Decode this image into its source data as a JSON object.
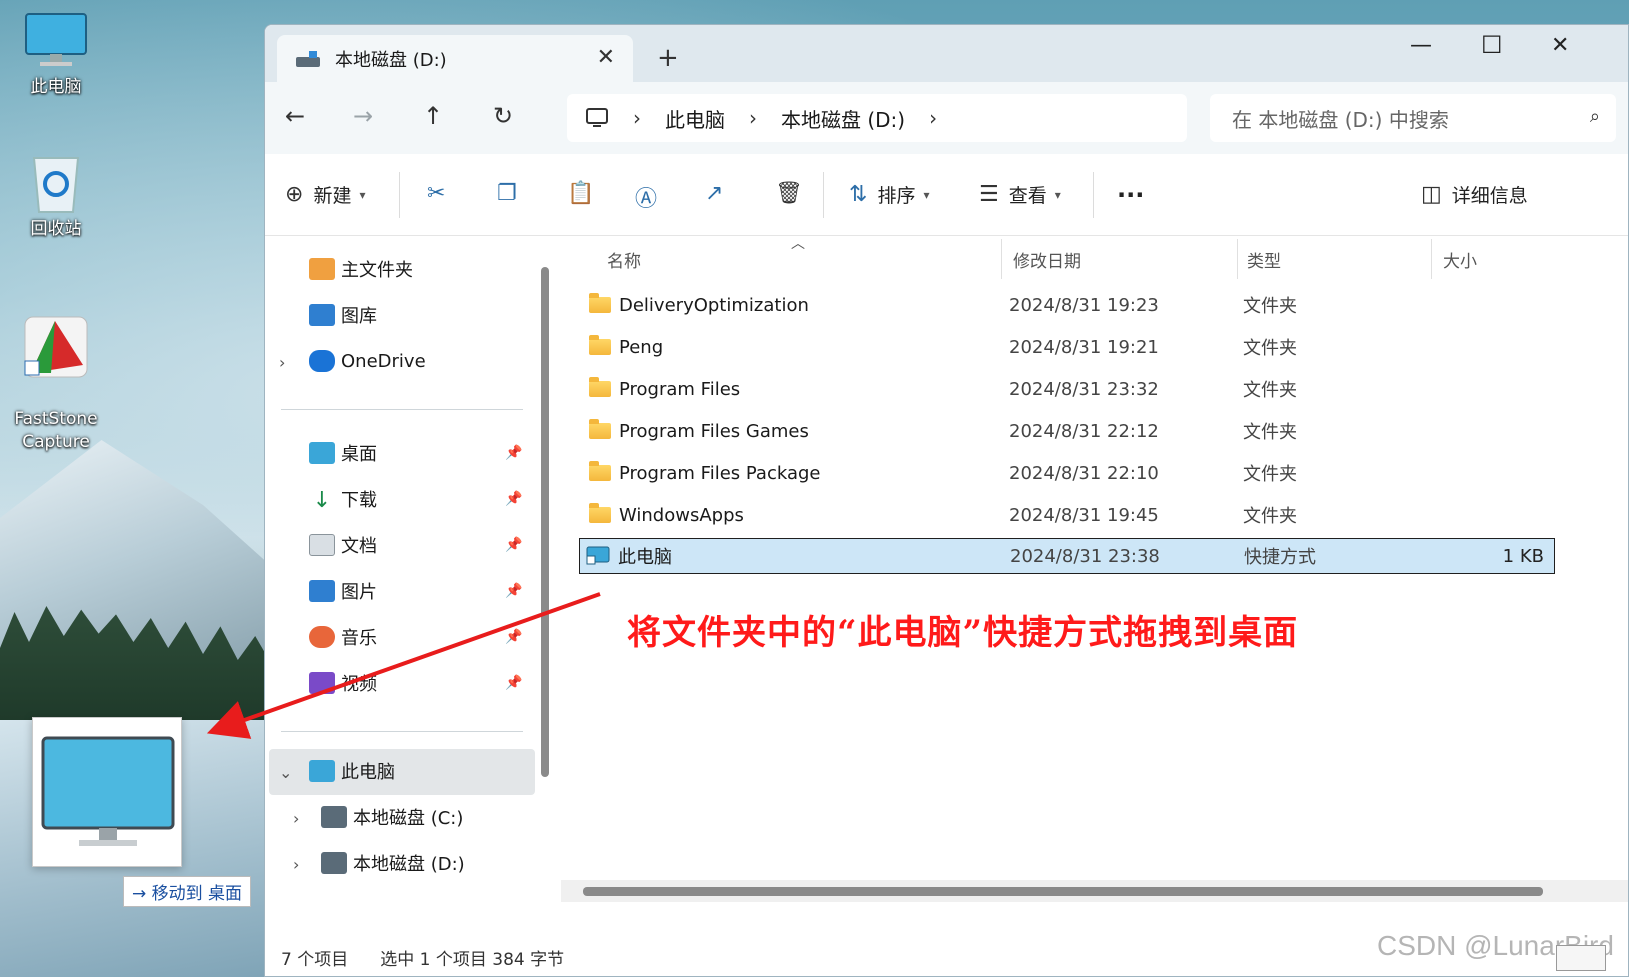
{
  "desktop": {
    "icons": [
      {
        "label": "此电脑"
      },
      {
        "label": "回收站"
      },
      {
        "label": "FastStone\nCapture"
      }
    ],
    "drag_tooltip": "→ 移动到 桌面"
  },
  "window": {
    "tab_title": "本地磁盘 (D:)",
    "address": {
      "crumbs": [
        "此电脑",
        "本地磁盘 (D:)"
      ]
    },
    "search_placeholder": "在 本地磁盘 (D:) 中搜索",
    "toolbar": {
      "new_label": "新建",
      "sort_label": "排序",
      "view_label": "查看",
      "details_label": "详细信息"
    },
    "nav": {
      "top": [
        "主文件夹",
        "图库",
        "OneDrive"
      ],
      "pinned": [
        "桌面",
        "下载",
        "文档",
        "图片",
        "音乐",
        "视频"
      ],
      "this_pc": "此电脑",
      "drives": [
        "本地磁盘 (C:)",
        "本地磁盘 (D:)"
      ]
    },
    "columns": {
      "name": "名称",
      "date": "修改日期",
      "type": "类型",
      "size": "大小"
    },
    "files": [
      {
        "name": "DeliveryOptimization",
        "date": "2024/8/31 19:23",
        "type": "文件夹",
        "size": ""
      },
      {
        "name": "Peng",
        "date": "2024/8/31 19:21",
        "type": "文件夹",
        "size": ""
      },
      {
        "name": "Program Files",
        "date": "2024/8/31 23:32",
        "type": "文件夹",
        "size": ""
      },
      {
        "name": "Program Files Games",
        "date": "2024/8/31 22:12",
        "type": "文件夹",
        "size": ""
      },
      {
        "name": "Program Files Package",
        "date": "2024/8/31 22:10",
        "type": "文件夹",
        "size": ""
      },
      {
        "name": "WindowsApps",
        "date": "2024/8/31 19:45",
        "type": "文件夹",
        "size": ""
      },
      {
        "name": "此电脑",
        "date": "2024/8/31 23:38",
        "type": "快捷方式",
        "size": "1 KB"
      }
    ],
    "status": {
      "count": "7 个项目",
      "selection": "选中 1 个项目  384 字节"
    }
  },
  "annotation": "将文件夹中的“此电脑”快捷方式拖拽到桌面",
  "watermark": "CSDN @LunarBird",
  "colors": {
    "selection": "#cde6f7",
    "annotation": "#ff1a1a",
    "accent": "#2d6ea8"
  }
}
